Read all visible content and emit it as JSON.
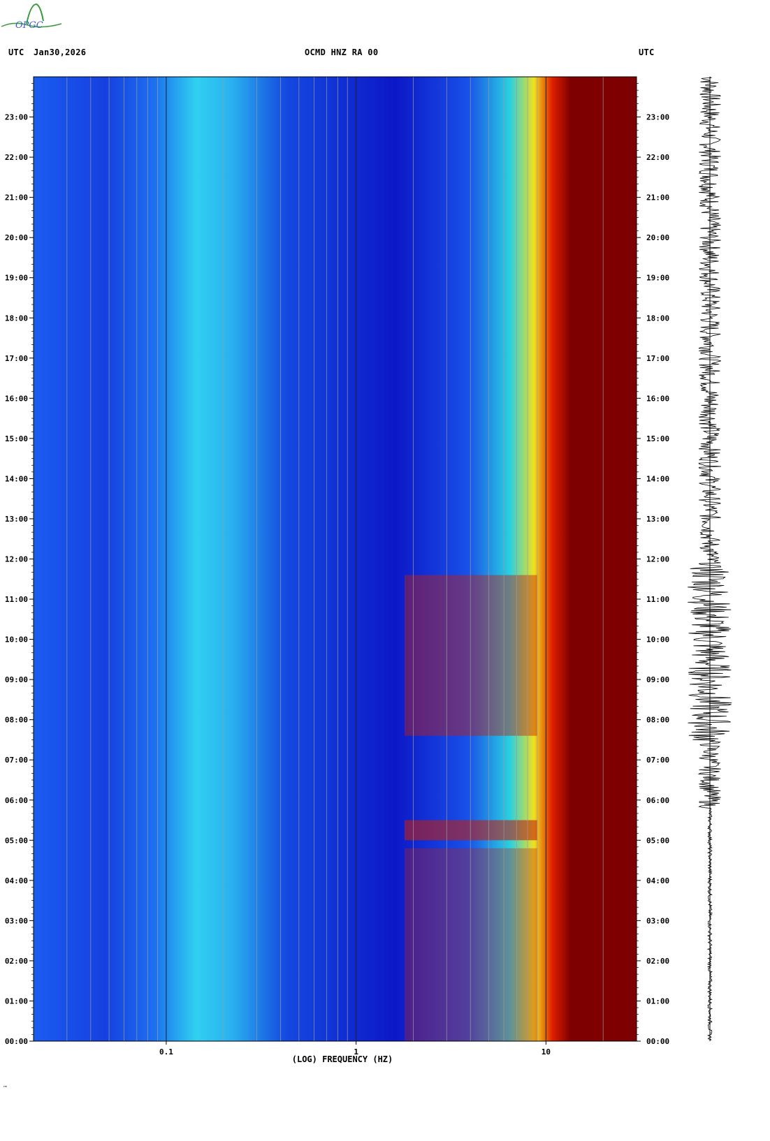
{
  "header": {
    "left_tz": "UTC",
    "date": "Jan30,2026",
    "station": "OCMD HNZ RA 00",
    "right_tz": "UTC"
  },
  "logo": {
    "text": "OPGC"
  },
  "chart_data": {
    "type": "heatmap",
    "title": "OCMD HNZ RA 00",
    "xlabel": "(LOG) FREQUENCY (HZ)",
    "x_scale": "log",
    "xlim": [
      0.02,
      30
    ],
    "x_ticks": [
      0.1,
      1,
      10
    ],
    "x_tick_labels": [
      "0.1",
      "1",
      "10"
    ],
    "y_ticks_hours": [
      0,
      1,
      2,
      3,
      4,
      5,
      6,
      7,
      8,
      9,
      10,
      11,
      12,
      13,
      14,
      15,
      16,
      17,
      18,
      19,
      20,
      21,
      22,
      23
    ],
    "y_tick_labels": [
      "00:00",
      "01:00",
      "02:00",
      "03:00",
      "04:00",
      "05:00",
      "06:00",
      "07:00",
      "08:00",
      "09:00",
      "10:00",
      "11:00",
      "12:00",
      "13:00",
      "14:00",
      "15:00",
      "16:00",
      "17:00",
      "18:00",
      "19:00",
      "20:00",
      "21:00",
      "22:00",
      "23:00"
    ],
    "ylim_hours": [
      0,
      24
    ],
    "colormap": "jet",
    "colors": {
      "low": "#00007f",
      "mid": "#00ffff",
      "high": "#7f0000"
    },
    "has_waveform_trace": true
  },
  "footer": {
    "mark": "™"
  }
}
